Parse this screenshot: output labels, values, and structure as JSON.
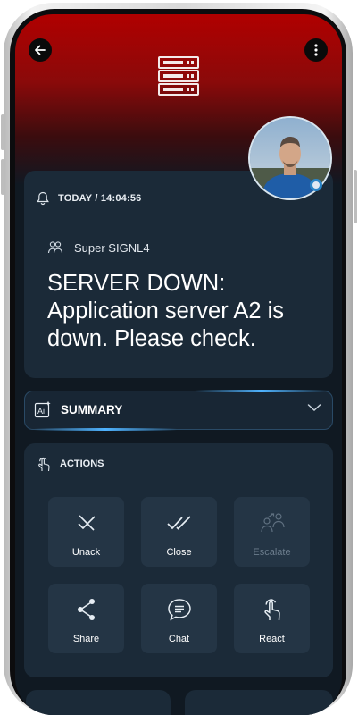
{
  "header": {
    "back_icon": "arrow-left-icon",
    "menu_icon": "more-vertical-icon",
    "type_icon": "server-icon"
  },
  "alert": {
    "timestamp": "TODAY / 14:04:56",
    "team": "Super SIGNL4",
    "text": "SERVER DOWN: Application server A2 is down. Please check."
  },
  "summary": {
    "label": "SUMMARY"
  },
  "actions": {
    "title": "ACTIONS",
    "items": [
      {
        "label": "Unack",
        "icon": "unack-icon",
        "enabled": true
      },
      {
        "label": "Close",
        "icon": "double-check-icon",
        "enabled": true
      },
      {
        "label": "Escalate",
        "icon": "escalate-icon",
        "enabled": false
      },
      {
        "label": "Share",
        "icon": "share-icon",
        "enabled": true
      },
      {
        "label": "Chat",
        "icon": "chat-icon",
        "enabled": true
      },
      {
        "label": "React",
        "icon": "tap-icon",
        "enabled": true
      }
    ]
  },
  "colors": {
    "header_red": "#b00000",
    "card_bg": "#1b2a38",
    "tile_bg": "#243545",
    "accent_blue": "#4fb3ff"
  }
}
